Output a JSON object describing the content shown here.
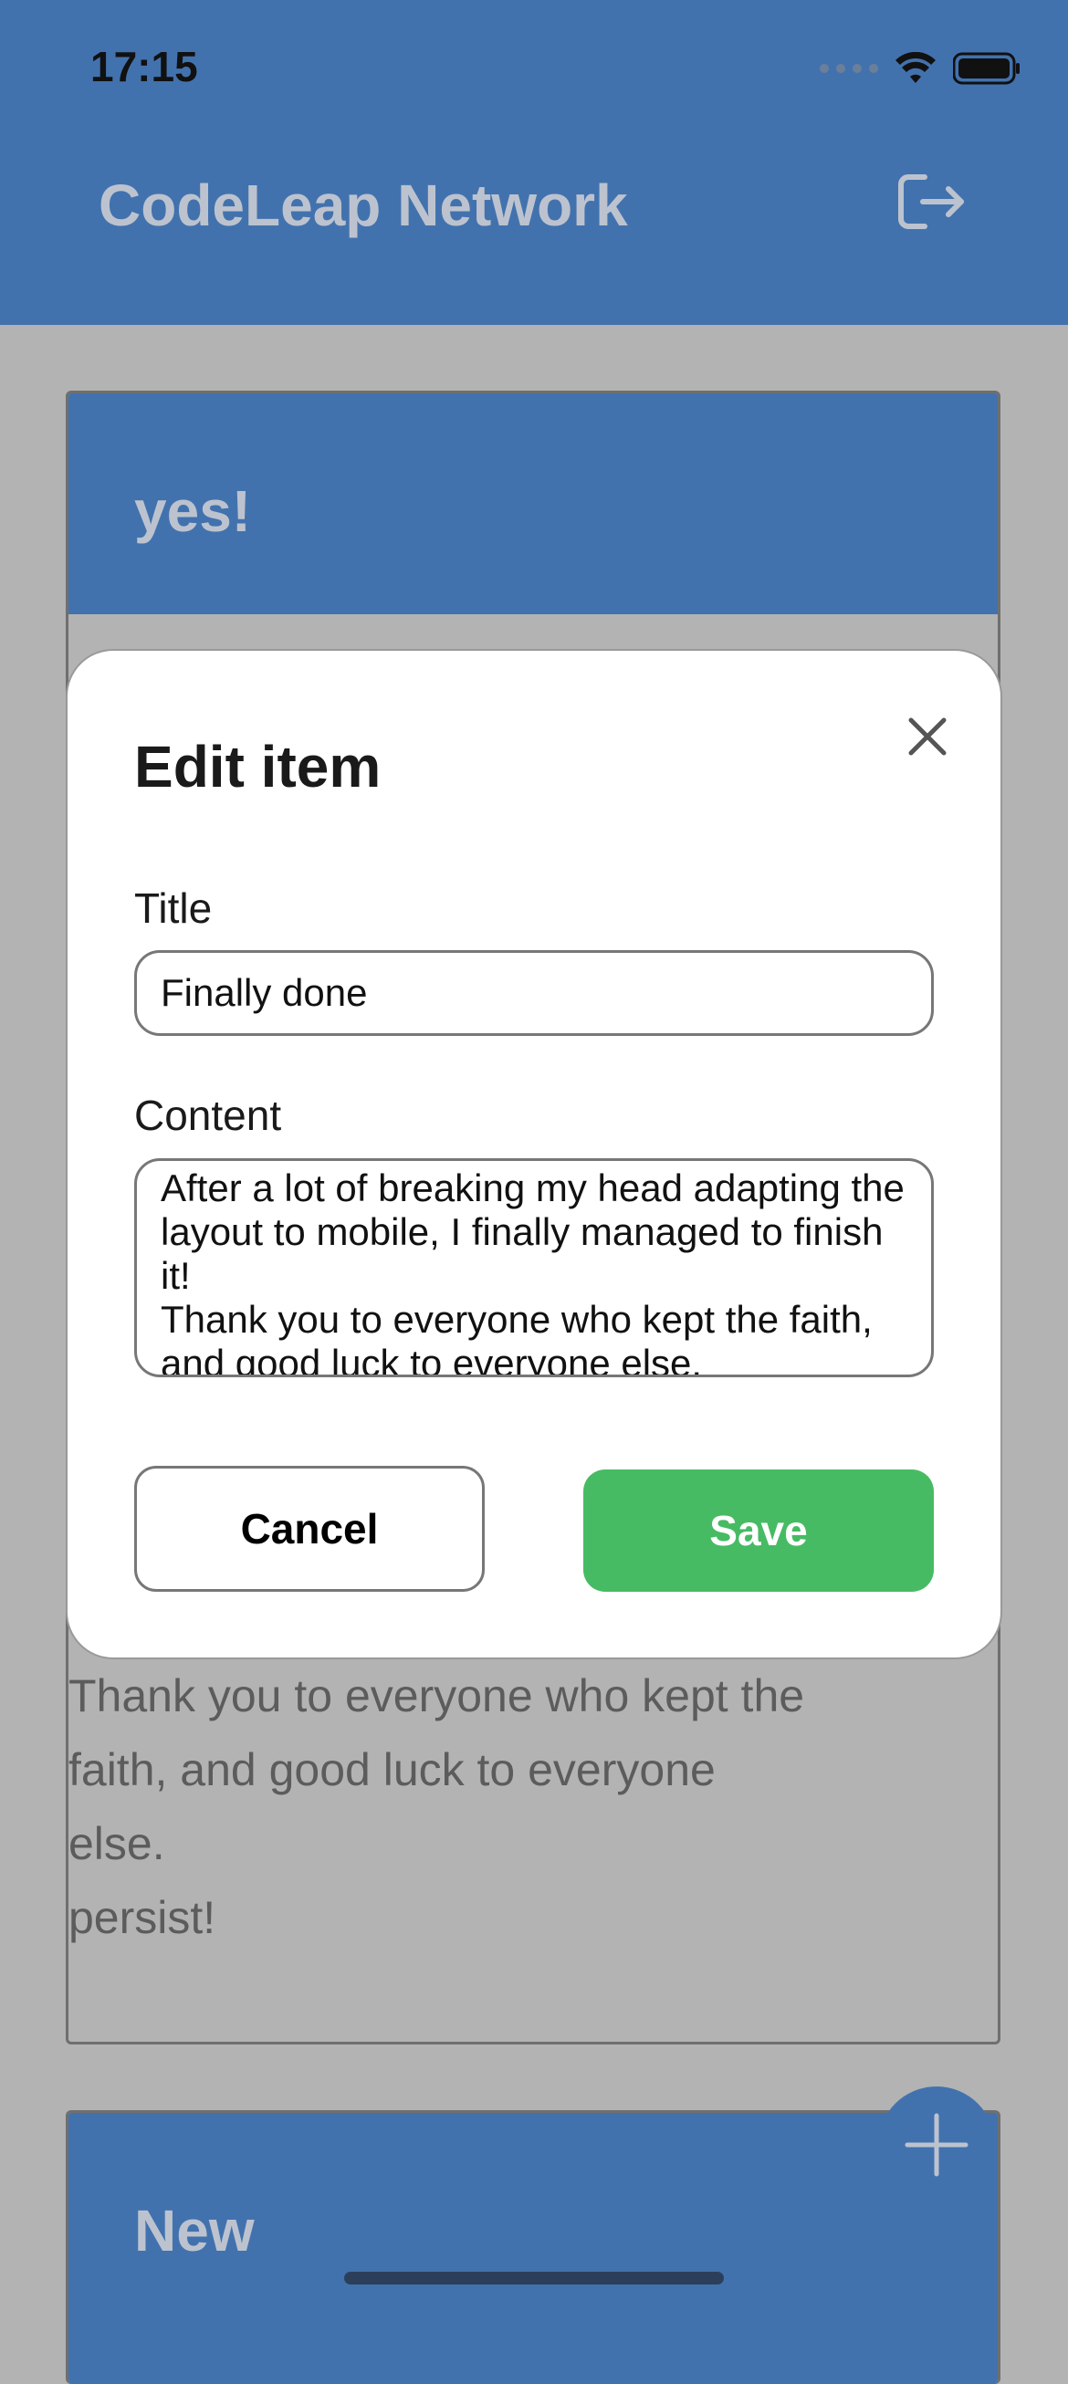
{
  "status_bar": {
    "time": "17:15"
  },
  "header": {
    "title": "CodeLeap Network",
    "logout_icon": "logout-icon"
  },
  "background_cards": [
    {
      "title": "yes!",
      "content_visible": [
        "Thank you to everyone who kept the",
        "faith, and good luck to everyone",
        "else.",
        "persist!"
      ]
    },
    {
      "title": "New"
    }
  ],
  "modal": {
    "heading": "Edit item",
    "title_label": "Title",
    "title_value": "Finally done",
    "content_label": "Content",
    "content_value": "After a lot of breaking my head adapting the layout to mobile, I finally managed to finish it!\nThank you to everyone who kept the faith, and good luck to everyone else.\npersist!",
    "cancel_label": "Cancel",
    "save_label": "Save"
  },
  "colors": {
    "header_blue": "#4272ae",
    "save_green": "#47bb63",
    "overlay_gray": "#b3b3b3"
  }
}
